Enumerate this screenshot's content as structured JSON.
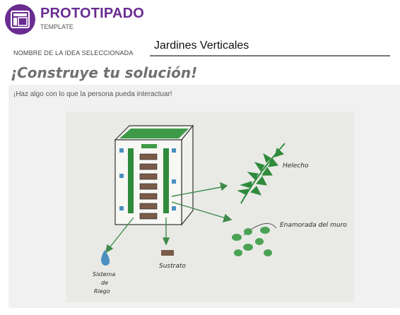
{
  "header": {
    "icon": "layout-template-icon",
    "title": "PROTOTIPADO",
    "subtitle": "TEMPLATE"
  },
  "idea": {
    "label": "NOMBRE DE LA IDEA SELECCIONADA",
    "value": "Jardines Verticales"
  },
  "section": {
    "heading": "¡Construye tu solución!",
    "instruction": "¡Haz algo con lo que la persona pueda interactuar!"
  },
  "sketch": {
    "labels": {
      "helecho": "Helecho",
      "enamorada": "Enamorada del muro",
      "sustrato": "Sustrato",
      "riego_1": "Sistema",
      "riego_2": "de",
      "riego_3": "Riego"
    }
  },
  "colors": {
    "brand_purple": "#6a2c91",
    "heading_gray": "#707070",
    "card_bg": "#f1f1f1",
    "plant_green": "#2f8a3c"
  }
}
